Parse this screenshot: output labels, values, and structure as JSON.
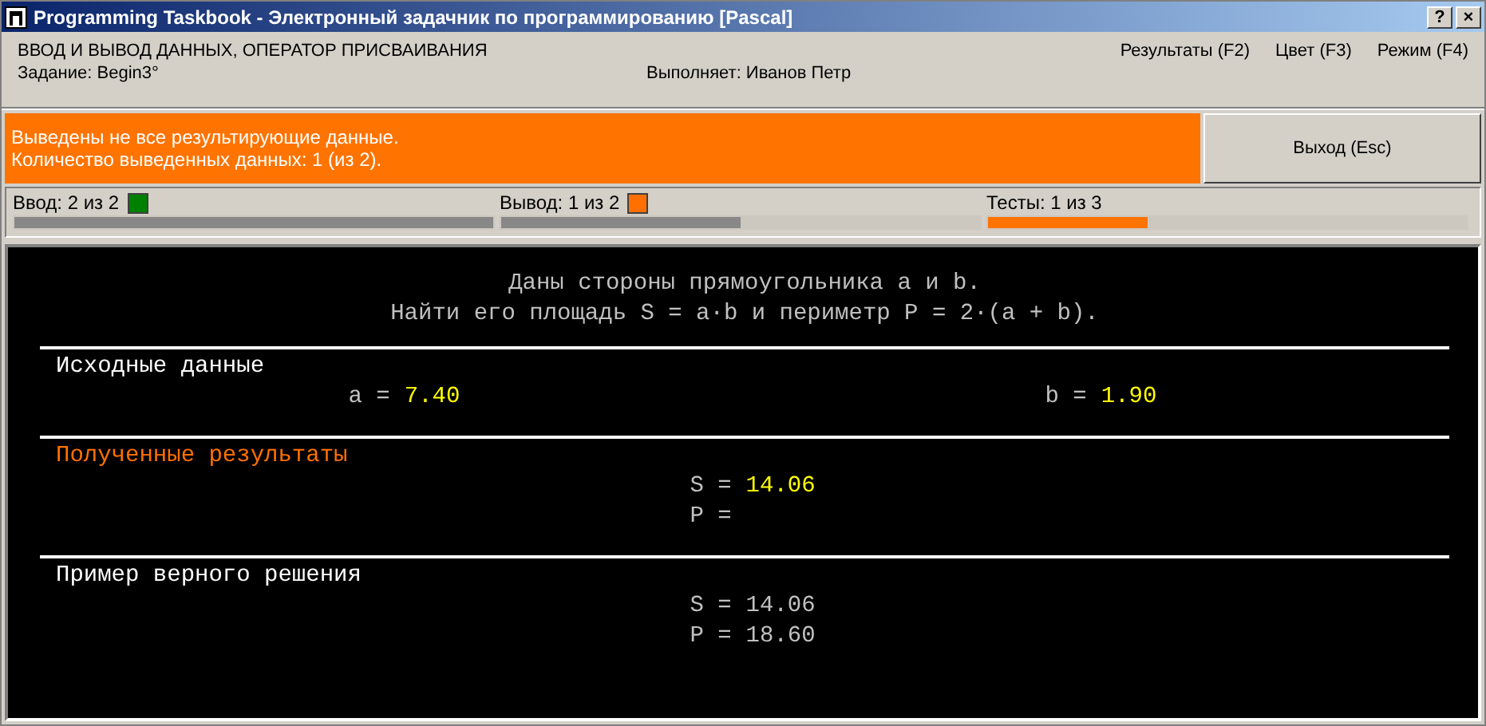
{
  "window": {
    "title": "Programming Taskbook - Электронный задачник по программированию [Pascal]",
    "buttons": [
      "?",
      "×"
    ]
  },
  "header": {
    "topic": "ВВОД И ВЫВОД ДАННЫХ, ОПЕРАТОР ПРИСВАИВАНИЯ",
    "task": "Задание: Begin3°",
    "student": "Выполняет: Иванов Петр",
    "menu": [
      "Результаты (F2)",
      "Цвет (F3)",
      "Режим (F4)"
    ]
  },
  "message": {
    "lines": [
      "Выведены не все результирующие данные.",
      "Количество выведенных данных: 1 (из 2)."
    ],
    "exit_button": "Выход (Esc)"
  },
  "status": [
    {
      "label": "Ввод: 2 из 2",
      "color": "#008000",
      "level": 1
    },
    {
      "label": "Вывод: 1 из 2",
      "color": "#ff7000",
      "level": 0.5
    },
    {
      "label": "Тесты: 1 из 3",
      "level": 0.333
    }
  ],
  "console": {
    "description": [
      "Даны стороны прямоугольника a и b.",
      "Найти его площадь S = a·b и периметр P = 2·(a + b)."
    ],
    "sections": [
      {
        "title": "Исходные данные",
        "color": "#ffffff",
        "kind": "input",
        "items": [
          {
            "name": "a =",
            "value": "7.40"
          },
          {
            "name": "b =",
            "value": "1.90"
          }
        ]
      },
      {
        "title": "Полученные результаты",
        "color": "#ff7000",
        "kind": "result",
        "items": [
          {
            "name": "S =",
            "value": "14.06"
          },
          {
            "name": "P ="
          }
        ]
      },
      {
        "title": "Пример верного решения",
        "color": "#ffffff",
        "kind": "sample",
        "items": [
          {
            "name": "S =",
            "value": "14.06"
          },
          {
            "name": "P =",
            "value": "18.60"
          }
        ]
      }
    ]
  }
}
